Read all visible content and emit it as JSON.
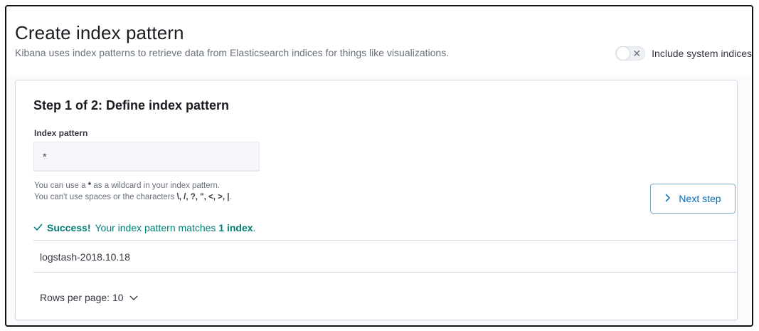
{
  "header": {
    "title": "Create index pattern",
    "subtitle": "Kibana uses index patterns to retrieve data from Elasticsearch indices for things like visualizations.",
    "system_indices_toggle": {
      "label": "Include system indices",
      "enabled": false
    }
  },
  "step": {
    "title": "Step 1 of 2: Define index pattern",
    "field_label": "Index pattern",
    "input_value": "*",
    "help_line1_pre": "You can use a ",
    "help_line1_bold": "*",
    "help_line1_post": " as a wildcard in your index pattern.",
    "help_line2_pre": "You can't use spaces or the characters ",
    "help_line2_chars": "\\, /, ?, \", <, >, |",
    "help_line2_post": ".",
    "next_button_label": "Next step"
  },
  "result": {
    "success_label": "Success!",
    "message_pre": "Your index pattern matches ",
    "match_count": "1 index",
    "message_post": "."
  },
  "table": {
    "rows": [
      "logstash-2018.10.18"
    ]
  },
  "pagination": {
    "rows_per_page_label": "Rows per page: 10"
  },
  "colors": {
    "success": "#017d73",
    "accent": "#006bb4"
  }
}
